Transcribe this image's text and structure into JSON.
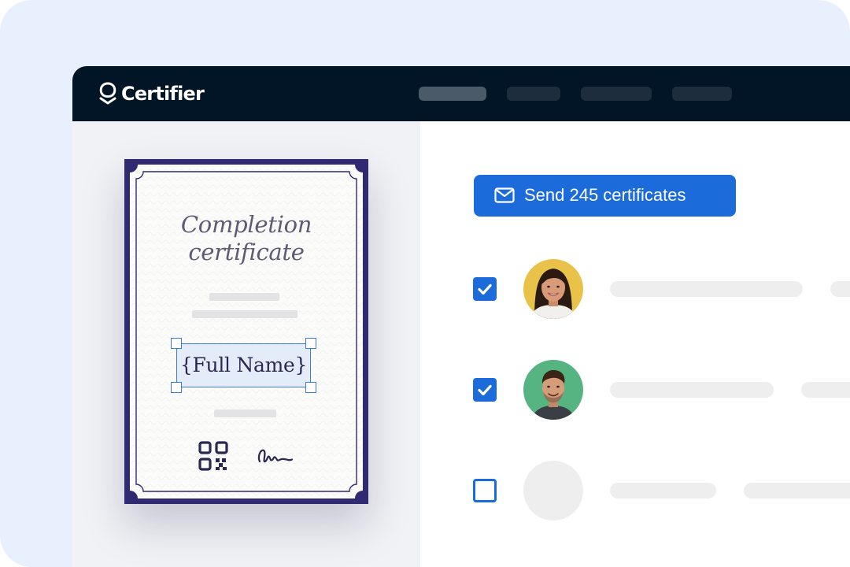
{
  "app": {
    "brand_name": "Certifier",
    "nav_items": [
      "",
      "",
      "",
      ""
    ]
  },
  "certificate": {
    "title_line1": "Completion",
    "title_line2": "certificate",
    "name_placeholder": "{Full Name}",
    "frame_color": "#302a72",
    "icons": [
      "qr-code-icon",
      "signature-icon"
    ]
  },
  "send_button": {
    "label": "Send 245 certificates",
    "icon": "mail-icon",
    "color": "#1c6bdb"
  },
  "recipients": [
    {
      "checked": true,
      "avatar": "woman-avatar",
      "avatar_bg": "#e9c24a"
    },
    {
      "checked": true,
      "avatar": "man-avatar",
      "avatar_bg": "#55b482"
    },
    {
      "checked": false,
      "avatar": "empty-avatar",
      "avatar_bg": "#eeeeef"
    }
  ]
}
